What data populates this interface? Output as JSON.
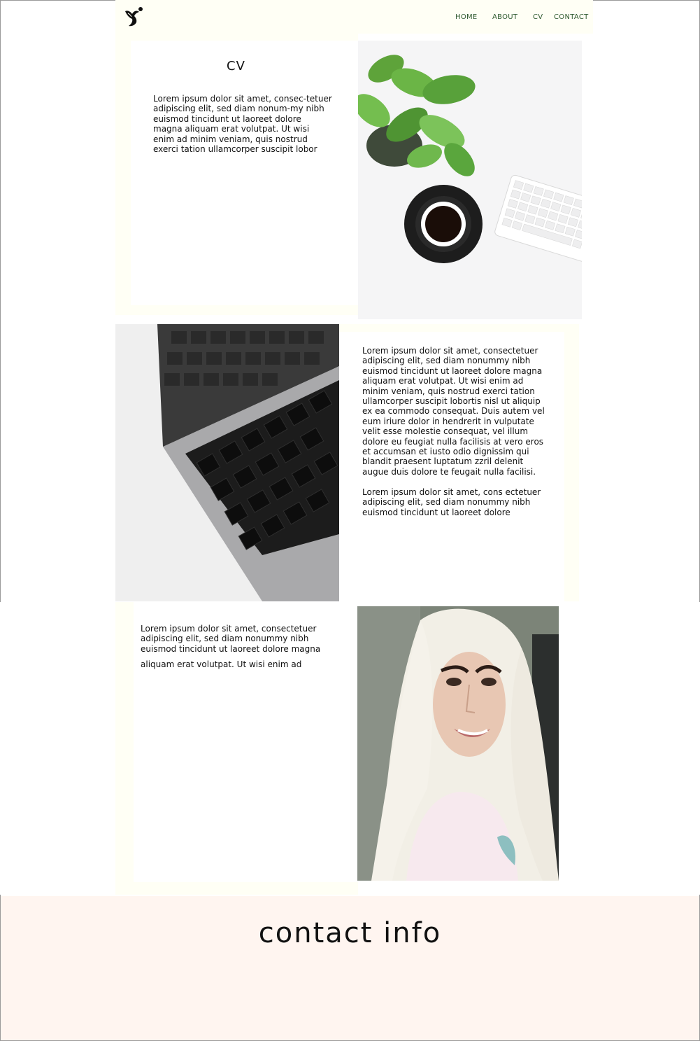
{
  "nav": {
    "links": [
      {
        "label": "HOME"
      },
      {
        "label": "ABOUT"
      },
      {
        "label": "CV"
      },
      {
        "label": "CONTACT"
      }
    ]
  },
  "section1": {
    "title": "CV",
    "text": "Lorem ipsum dolor sit amet, consec-tetuer adipiscing elit, sed diam nonum-my nibh euismod tincidunt ut laoreet dolore magna aliquam erat volutpat. Ut wisi enim ad minim veniam, quis nostrud exerci tation ullamcorper suscipit lobor"
  },
  "section2": {
    "text": "Lorem ipsum dolor sit amet, consectetuer adipiscing elit, sed diam nonummy nibh euismod tincidunt ut laoreet dolore magna aliquam erat volutpat. Ut wisi enim ad minim veniam, quis nostrud exerci tation ullamcorper suscipit lobortis nisl ut aliquip ex ea commodo consequat. Duis autem vel eum iriure dolor in hendrerit in vulputate velit esse molestie consequat, vel illum dolore eu feugiat nulla facilisis at vero eros et accumsan et iusto odio dignissim qui blandit praesent luptatum zzril delenit augue duis dolore te feugait nulla facilisi.",
    "text2": "Lorem ipsum dolor sit amet, cons ectetuer adipiscing elit, sed diam nonummy nibh euismod tincidunt ut laoreet dolore"
  },
  "section3": {
    "text": "Lorem ipsum dolor sit amet, consectetuer adipiscing elit, sed diam nonummy nibh euismod tincidunt ut laoreet dolore magna",
    "text2": "aliquam erat volutpat. Ut wisi enim ad"
  },
  "contact": {
    "title": "contact info"
  },
  "colors": {
    "nav_text": "#2f5a2f",
    "band": "#fffff5",
    "contact_bg": "#fff5f0"
  }
}
